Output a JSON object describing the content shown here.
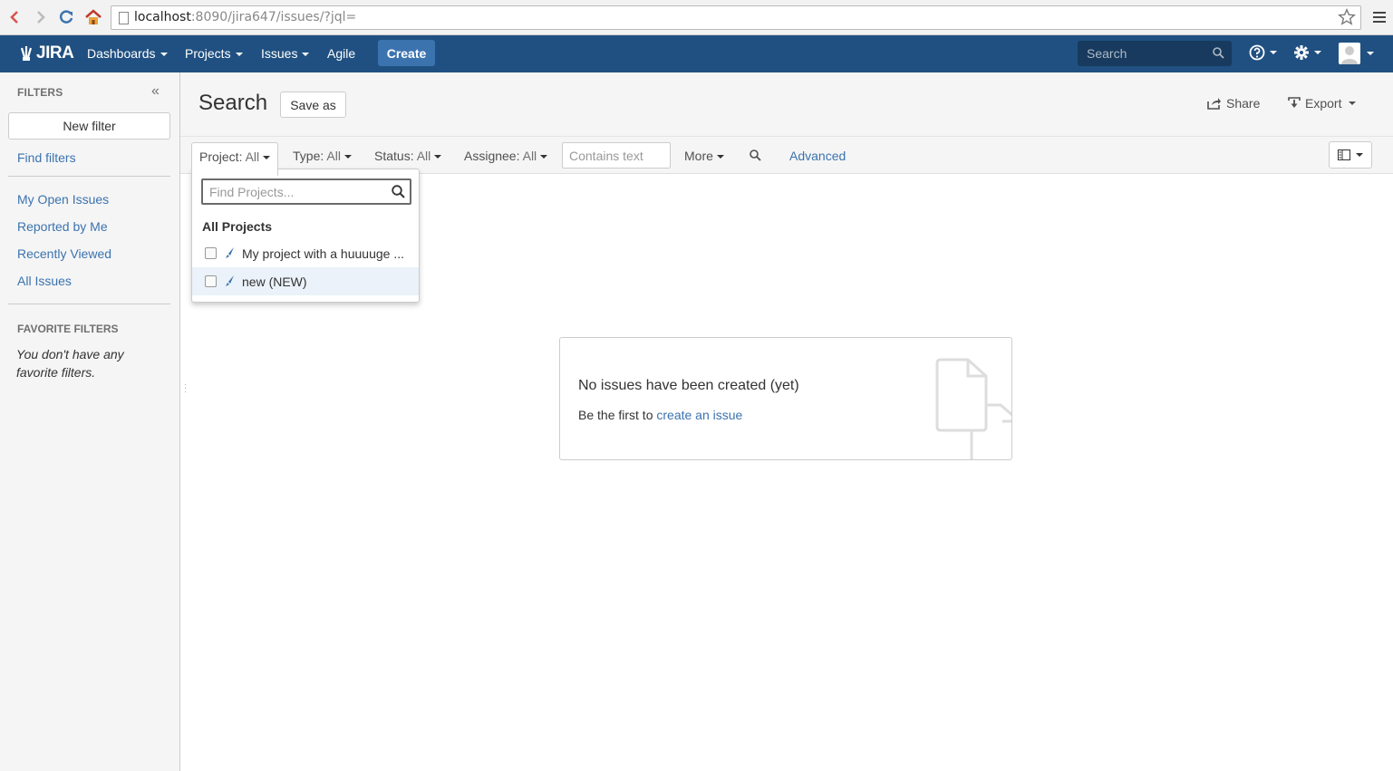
{
  "browser": {
    "url_host": "localhost",
    "url_rest": ":8090/jira647/issues/?jql="
  },
  "header": {
    "logo": "JIRA",
    "nav": {
      "dashboards": "Dashboards",
      "projects": "Projects",
      "issues": "Issues",
      "agile": "Agile"
    },
    "create": "Create",
    "search_placeholder": "Search"
  },
  "sidebar": {
    "title": "FILTERS",
    "new_filter": "New filter",
    "find_filters": "Find filters",
    "links": {
      "my_open": "My Open Issues",
      "reported": "Reported by Me",
      "recent": "Recently Viewed",
      "all": "All Issues"
    },
    "favorites_title": "FAVORITE FILTERS",
    "favorites_empty": "You don't have any favorite filters."
  },
  "main": {
    "title": "Search",
    "save_as": "Save as",
    "share": "Share",
    "export": "Export"
  },
  "filters": {
    "project_label": "Project:",
    "project_value": "All",
    "type_label": "Type:",
    "type_value": "All",
    "status_label": "Status:",
    "status_value": "All",
    "assignee_label": "Assignee:",
    "assignee_value": "All",
    "contains_placeholder": "Contains text",
    "more": "More",
    "advanced": "Advanced"
  },
  "project_dropdown": {
    "search_placeholder": "Find Projects...",
    "heading": "All Projects",
    "items": [
      {
        "label": "My project with a huuuuge ..."
      },
      {
        "label": "new (NEW)"
      }
    ]
  },
  "empty_state": {
    "title": "No issues have been created (yet)",
    "text": "Be the first to",
    "link": "create an issue"
  },
  "colors": {
    "header_bg": "#205081",
    "link": "#3b73af",
    "create_bg": "#3b73af"
  }
}
